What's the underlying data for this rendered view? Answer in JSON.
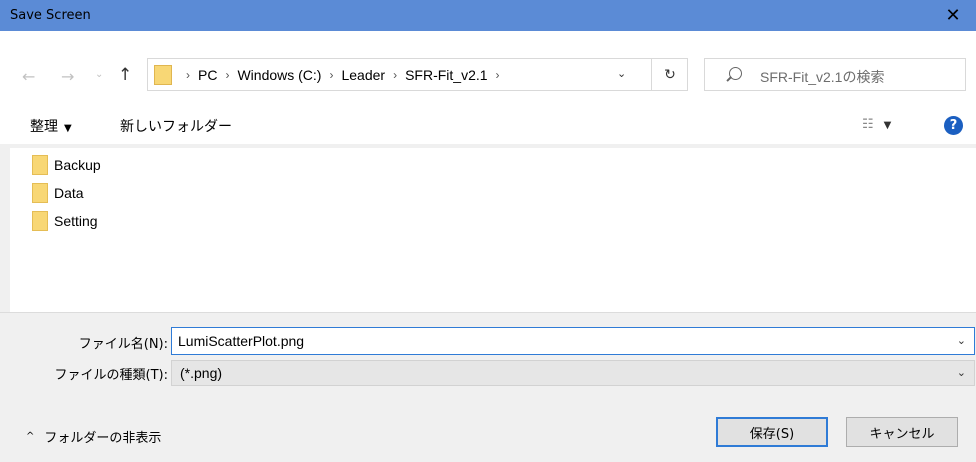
{
  "window": {
    "title": "Save Screen",
    "close_glyph": "✕"
  },
  "nav": {
    "back_glyph": "←",
    "forward_glyph": "→",
    "dropdown_glyph": "⌄",
    "up_glyph": "↑",
    "breadcrumbs": [
      "PC",
      "Windows (C:)",
      "Leader",
      "SFR-Fit_v2.1"
    ],
    "separator": "›",
    "address_dropdown_glyph": "⌄",
    "refresh_glyph": "↻",
    "search_placeholder": "SFR-Fit_v2.1の検索"
  },
  "toolbar": {
    "organize_label": "整理",
    "organize_caret": "▼",
    "new_folder_label": "新しいフォルダー",
    "view_glyph": "☷",
    "view_caret": "▼",
    "help_glyph": "?"
  },
  "files": [
    {
      "name": "Backup"
    },
    {
      "name": "Data"
    },
    {
      "name": "Setting"
    }
  ],
  "form": {
    "file_name_label": "ファイル名(N):",
    "file_name_value": "LumiScatterPlot.png",
    "file_type_label": "ファイルの種類(T):",
    "file_type_value": "(*.png)",
    "dropdown_glyph": "⌄"
  },
  "footer": {
    "hide_folders_caret": "^",
    "hide_folders_label": "フォルダーの非表示",
    "save_label": "保存(S)",
    "cancel_label": "キャンセル"
  }
}
